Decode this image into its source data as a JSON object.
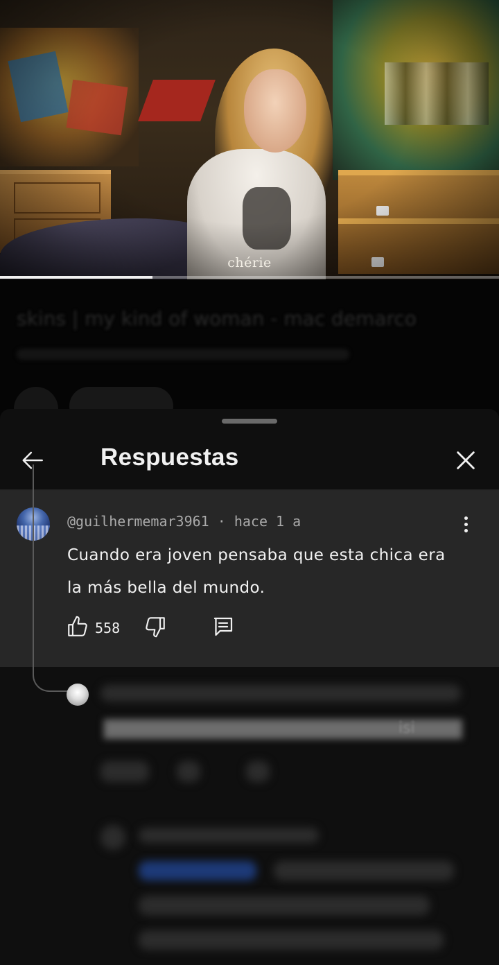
{
  "video": {
    "caption": "chérie",
    "progress": 0.305
  },
  "sheet": {
    "title": "Respuestas",
    "back_icon": "arrow-left-icon",
    "close_icon": "close-icon"
  },
  "comment": {
    "author": "@guilhermemar3961",
    "separator": "·",
    "time": "hace 1 a",
    "text": "Cuando era joven pensaba que esta chica era la más bella del mundo.",
    "likes": "558",
    "icons": {
      "like": "thumb-up-icon",
      "dislike": "thumb-down-icon",
      "reply": "reply-icon",
      "more": "more-vert-icon"
    }
  },
  "colors": {
    "sheet_bg": "#0f0f0f",
    "comment_bg": "#272727",
    "text_primary": "#f1f1f1",
    "text_secondary": "#aaaaaa"
  }
}
